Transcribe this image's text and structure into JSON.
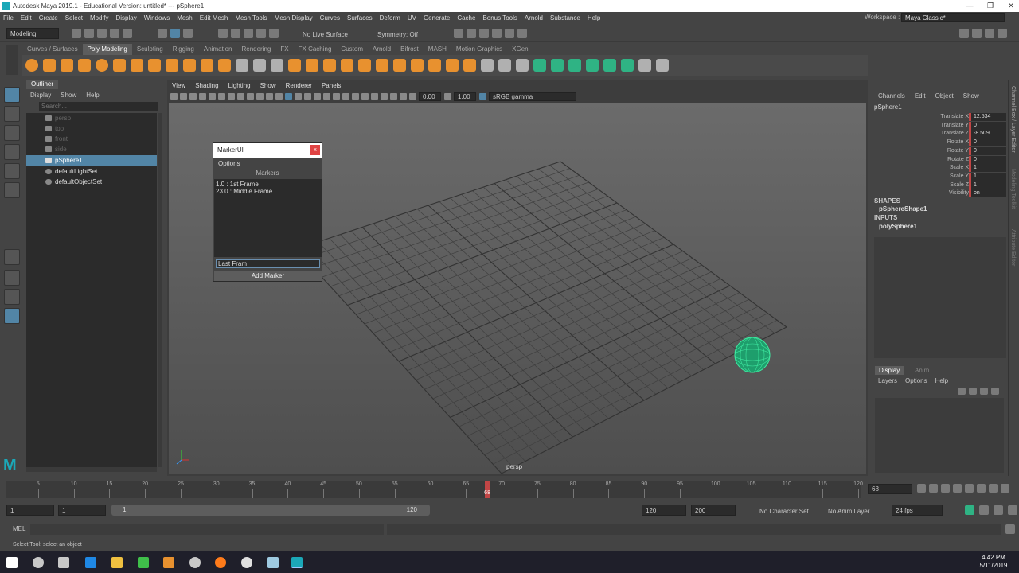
{
  "window": {
    "title": "Autodesk Maya 2019.1 - Educational Version: untitled*   ---   pSphere1",
    "controls": [
      "—",
      "❐",
      "✕"
    ]
  },
  "menubar": {
    "items": [
      "File",
      "Edit",
      "Create",
      "Select",
      "Modify",
      "Display",
      "Windows",
      "Mesh",
      "Edit Mesh",
      "Mesh Tools",
      "Mesh Display",
      "Curves",
      "Surfaces",
      "Deform",
      "UV",
      "Generate",
      "Cache",
      "Bonus Tools",
      "Arnold",
      "Substance",
      "Help"
    ],
    "workspace_label": "Workspace :",
    "workspace_value": "Maya Classic*"
  },
  "statusline": {
    "mode": "Modeling",
    "live_surface": "No Live Surface",
    "symmetry": "Symmetry: Off"
  },
  "shelf": {
    "tabs": [
      "Curves / Surfaces",
      "Poly Modeling",
      "Sculpting",
      "Rigging",
      "Animation",
      "Rendering",
      "FX",
      "FX Caching",
      "Custom",
      "Arnold",
      "Bifrost",
      "MASH",
      "Motion Graphics",
      "XGen"
    ],
    "active_tab": "Poly Modeling"
  },
  "outliner": {
    "title": "Outliner",
    "menu": [
      "Display",
      "Show",
      "Help"
    ],
    "search_placeholder": "Search...",
    "items": [
      {
        "label": "persp",
        "state": "dim"
      },
      {
        "label": "top",
        "state": "dim"
      },
      {
        "label": "front",
        "state": "dim"
      },
      {
        "label": "side",
        "state": "dim"
      },
      {
        "label": "pSphere1",
        "state": "selected"
      },
      {
        "label": "defaultLightSet",
        "state": "normal"
      },
      {
        "label": "defaultObjectSet",
        "state": "normal"
      }
    ]
  },
  "viewport": {
    "menu": [
      "View",
      "Shading",
      "Lighting",
      "Show",
      "Renderer",
      "Panels"
    ],
    "exposure": "0.00",
    "gamma": "1.00",
    "color_space": "sRGB gamma",
    "camera_label": "persp"
  },
  "marker_ui": {
    "title": "MarkerUI",
    "close": "x",
    "menu": "Options",
    "list_header": "Markers",
    "markers": [
      "1.0 : 1st Frame",
      "23.0 : Middle Frame"
    ],
    "input_value": "Last Fram",
    "add_button": "Add Marker"
  },
  "channel_box": {
    "menu": [
      "Channels",
      "Edit",
      "Object",
      "Show"
    ],
    "object_name": "pSphere1",
    "attributes": [
      {
        "label": "Translate X",
        "value": "12.534"
      },
      {
        "label": "Translate Y",
        "value": "0"
      },
      {
        "label": "Translate Z",
        "value": "-8.509"
      },
      {
        "label": "Rotate X",
        "value": "0"
      },
      {
        "label": "Rotate Y",
        "value": "0"
      },
      {
        "label": "Rotate Z",
        "value": "0"
      },
      {
        "label": "Scale X",
        "value": "1"
      },
      {
        "label": "Scale Y",
        "value": "1"
      },
      {
        "label": "Scale Z",
        "value": "1"
      },
      {
        "label": "Visibility",
        "value": "on"
      }
    ],
    "shapes_header": "SHAPES",
    "shape_name": "pSphereShape1",
    "inputs_header": "INPUTS",
    "input_name": "polySphere1"
  },
  "layer_editor": {
    "tabs": [
      "Display",
      "Anim"
    ],
    "active_tab": "Display",
    "menu": [
      "Layers",
      "Options",
      "Help"
    ]
  },
  "side_tabs": [
    "Channel Box / Layer Editor",
    "Modeling Toolkit",
    "Attribute Editor"
  ],
  "timeline": {
    "ticks": [
      "5",
      "10",
      "15",
      "20",
      "25",
      "30",
      "35",
      "40",
      "45",
      "50",
      "55",
      "60",
      "65",
      "70",
      "75",
      "80",
      "85",
      "90",
      "95",
      "100",
      "105",
      "110",
      "115",
      "120"
    ],
    "current_frame": "68",
    "current_frame_field": "68"
  },
  "range": {
    "start": "1",
    "playback_start": "1",
    "slider_start": "1",
    "slider_end": "120",
    "playback_end": "120",
    "end": "200",
    "character_set": "No Character Set",
    "anim_layer": "No Anim Layer",
    "fps": "24 fps"
  },
  "command_line": {
    "label": "MEL"
  },
  "help_line": {
    "text": "Select Tool: select an object"
  },
  "taskbar": {
    "time": "4:42 PM",
    "date": "5/11/2019"
  },
  "colors": {
    "accent": "#5285a6",
    "sphere": "#3ee8a0",
    "close_red": "#e04343"
  }
}
